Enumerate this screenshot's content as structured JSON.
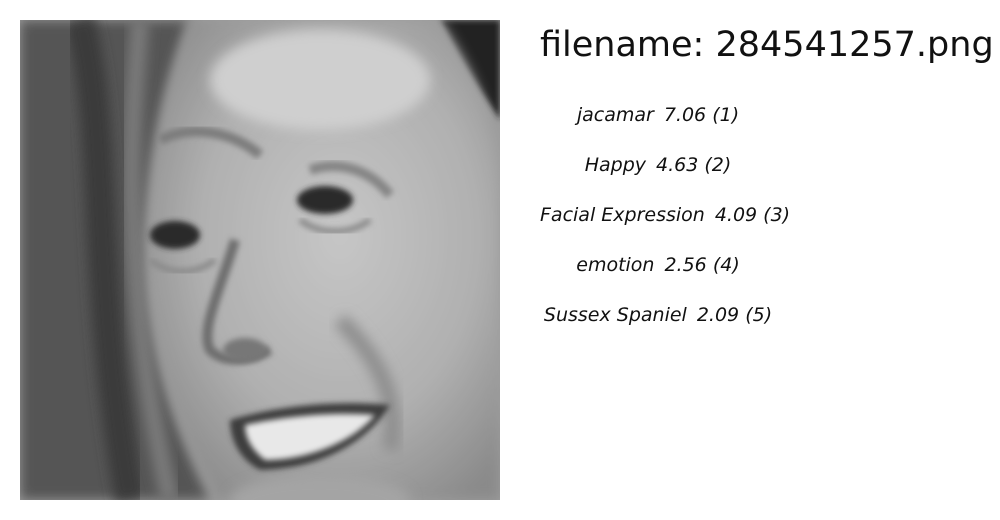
{
  "file": {
    "label": "filename:",
    "name": "284541257.png"
  },
  "image": {
    "subject": "grayscale close-up of a smiling woman's face"
  },
  "predictions": [
    {
      "label": "jacamar",
      "score": "7.06",
      "rank": "(1)"
    },
    {
      "label": "Happy",
      "score": "4.63",
      "rank": "(2)"
    },
    {
      "label": "Facial Expression",
      "score": "4.09",
      "rank": "(3)"
    },
    {
      "label": "emotion",
      "score": "2.56",
      "rank": "(4)"
    },
    {
      "label": "Sussex Spaniel",
      "score": "2.09",
      "rank": "(5)"
    }
  ]
}
